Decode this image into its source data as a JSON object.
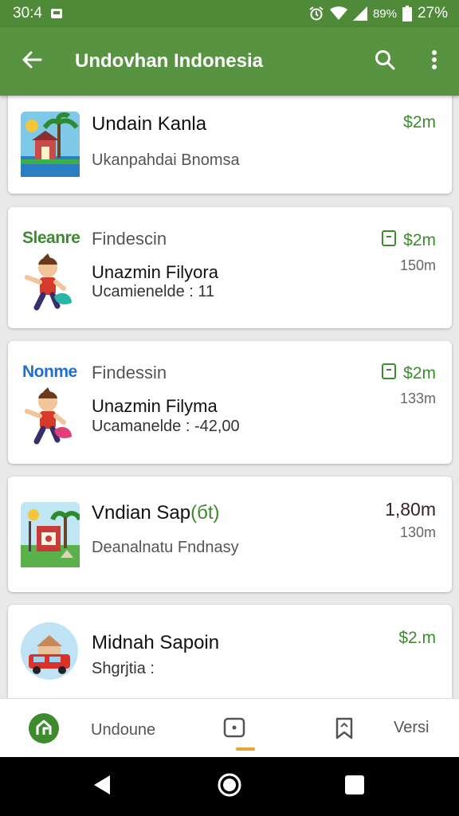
{
  "status_bar": {
    "time": "30:4",
    "battery_text": "89%",
    "battery_percent": "27%",
    "icons": [
      "notification-icon",
      "alarm-icon",
      "wifi-icon",
      "signal-icon",
      "battery-icon"
    ]
  },
  "app_bar": {
    "title": "Undovhan Indonesia",
    "icons": [
      "back-arrow-icon",
      "search-icon",
      "more-vert-icon"
    ]
  },
  "items": [
    {
      "title": "Undain Kanla",
      "subtitle": "Ukanpahdai Bnomsa",
      "price": "$2m"
    },
    {
      "brand": "Sleanre",
      "category": "Findescin",
      "title": "Unazmin Filyora",
      "subtitle": "Ucamienelde : 11",
      "price": "$2m",
      "meta": "150m"
    },
    {
      "brand": "Nonme",
      "category": "Findessin",
      "title": "Unazmin Filyma",
      "subtitle": "Ucamanelde : -42,00",
      "price": "$2m",
      "meta": "133m"
    },
    {
      "title_main": "Vndian Sap",
      "title_accent": "(бt)",
      "subtitle": "Deanalnatu Fndnasy",
      "price": "1,80m",
      "meta": "130m"
    },
    {
      "title": "Midnah Sapoin",
      "subtitle": "Shgrjtia :",
      "price": "$2.m"
    }
  ],
  "bottom_nav": {
    "home_label": "Undoune",
    "versi_label": "Versi"
  },
  "colors": {
    "status_bar": "#4f8a38",
    "app_bar": "#579341",
    "price_green": "#3e8a2f",
    "brand_green": "#3e8a2f",
    "brand_blue": "#1f6fd1",
    "indicator": "#e8a33a"
  }
}
